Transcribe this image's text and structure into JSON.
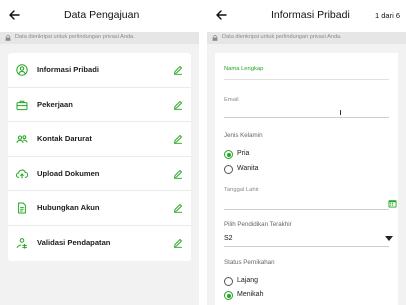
{
  "left_screen": {
    "title": "Data Pengajuan",
    "privacy_notice": "Data dienkripsi untuk perlindungan privasi Anda.",
    "menu": [
      {
        "label": "Informasi Pribadi",
        "icon": "user-icon"
      },
      {
        "label": "Pekerjaan",
        "icon": "briefcase-icon"
      },
      {
        "label": "Kontak Darurat",
        "icon": "contacts-icon"
      },
      {
        "label": "Upload Dokumen",
        "icon": "cloud-upload-icon"
      },
      {
        "label": "Hubungkan Akun",
        "icon": "document-icon"
      },
      {
        "label": "Validasi Pendapatan",
        "icon": "income-icon"
      }
    ]
  },
  "right_screen": {
    "title": "Informasi Pribadi",
    "step": "1 dari 6",
    "privacy_notice": "Data dienkripsi untuk perlindungan privasi Anda.",
    "form": {
      "full_name_label": "Nama Lengkap",
      "email_label": "Email",
      "gender_label": "Jenis Kelamin",
      "gender_options": [
        "Pria",
        "Wanita"
      ],
      "gender_selected": "Pria",
      "birth_date_label": "Tanggal Lahir",
      "education_label": "Pilih Pendidikan Terakhir",
      "education_value": "S2",
      "marital_label": "Status Pernikahan",
      "marital_options": [
        "Lajang",
        "Menikah"
      ],
      "marital_selected": "Menikah"
    }
  },
  "colors": {
    "accent": "#22a722",
    "background": "#f2f2f2",
    "card": "#ffffff",
    "banner": "#e6e6e6"
  }
}
